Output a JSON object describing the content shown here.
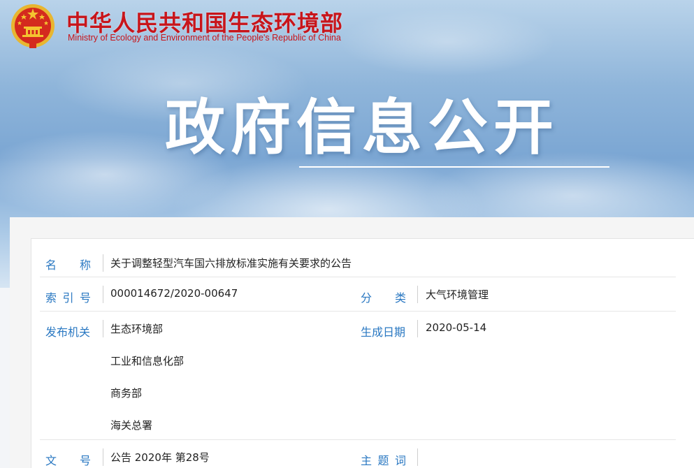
{
  "header": {
    "org_name_cn": "中华人民共和国生态环境部",
    "org_name_en": "Ministry of Ecology and Environment of the People's Republic of China",
    "banner_title": "政府信息公开"
  },
  "colors": {
    "brand_red": "#c8151b",
    "label_blue": "#2a78c2"
  },
  "details": {
    "name": {
      "label_chars": [
        "名",
        "称"
      ],
      "value": "关于调整轻型汽车国六排放标准实施有关要求的公告"
    },
    "index_no": {
      "label_chars": [
        "索",
        "引",
        "号"
      ],
      "value": "000014672/2020-00647"
    },
    "category": {
      "label_chars": [
        "分",
        "类"
      ],
      "value": "大气环境管理"
    },
    "issuer": {
      "label": "发布机关",
      "values": [
        "生态环境部",
        "工业和信息化部",
        "商务部",
        "海关总署"
      ]
    },
    "date": {
      "label": "生成日期",
      "value": "2020-05-14"
    },
    "doc_no": {
      "label_chars": [
        "文",
        "号"
      ],
      "value": "公告 2020年 第28号"
    },
    "keywords": {
      "label_chars": [
        "主",
        "题",
        "词"
      ],
      "value": ""
    }
  }
}
